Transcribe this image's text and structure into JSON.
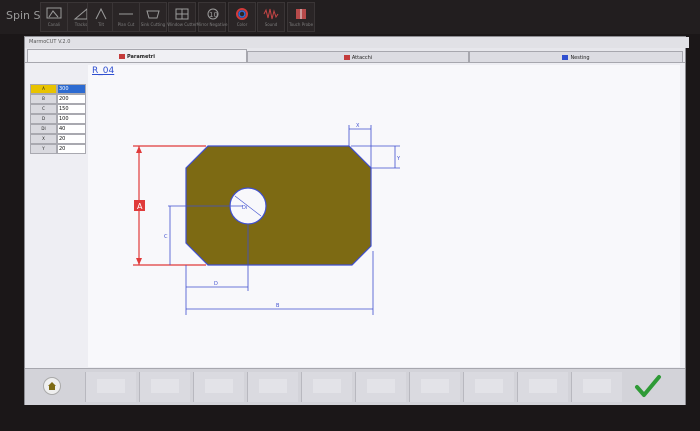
{
  "brand": "Spin S",
  "window_title": "MarmoCUT V.2.0",
  "toolbar": {
    "buttons": [
      {
        "label": "Canali",
        "icon": "frame-icon"
      },
      {
        "label": "Tracks",
        "icon": "slope-icon"
      },
      {
        "label": "Tilt",
        "icon": "angle-icon"
      },
      {
        "label": "Plan Cut",
        "icon": "line-icon"
      },
      {
        "label": "Sink Cutting",
        "icon": "sink-icon"
      },
      {
        "label": "Window Cutter",
        "icon": "grid-icon"
      },
      {
        "label": "Mirror Negative",
        "icon": "number-icon"
      },
      {
        "label": "Color",
        "icon": "palette-icon"
      },
      {
        "label": "Sound",
        "icon": "wave-icon"
      },
      {
        "label": "Touch Probe",
        "icon": "probe-icon"
      }
    ]
  },
  "tabs": [
    {
      "label": "Parametri",
      "active": true
    },
    {
      "label": "Attacchi",
      "active": false
    },
    {
      "label": "Nesting",
      "active": false
    }
  ],
  "params": [
    {
      "label": "A",
      "value": "300"
    },
    {
      "label": "B",
      "value": "200"
    },
    {
      "label": "C",
      "value": "150"
    },
    {
      "label": "D",
      "value": "100"
    },
    {
      "label": "DI",
      "value": "40"
    },
    {
      "label": "X",
      "value": "20"
    },
    {
      "label": "Y",
      "value": "20"
    }
  ],
  "shape_name": "R_04",
  "dimensions": {
    "a": "A",
    "b": "B",
    "c": "C",
    "d": "D",
    "di": "Di",
    "x": "X",
    "y": "Y"
  },
  "colors": {
    "piece": "#7d6a13",
    "outline": "#3f4fcf",
    "selected_dim": "#e03a3a",
    "highlight": "#e8c300",
    "selected_value": "#2d6bd1"
  },
  "footer": {
    "buttons": 11
  }
}
